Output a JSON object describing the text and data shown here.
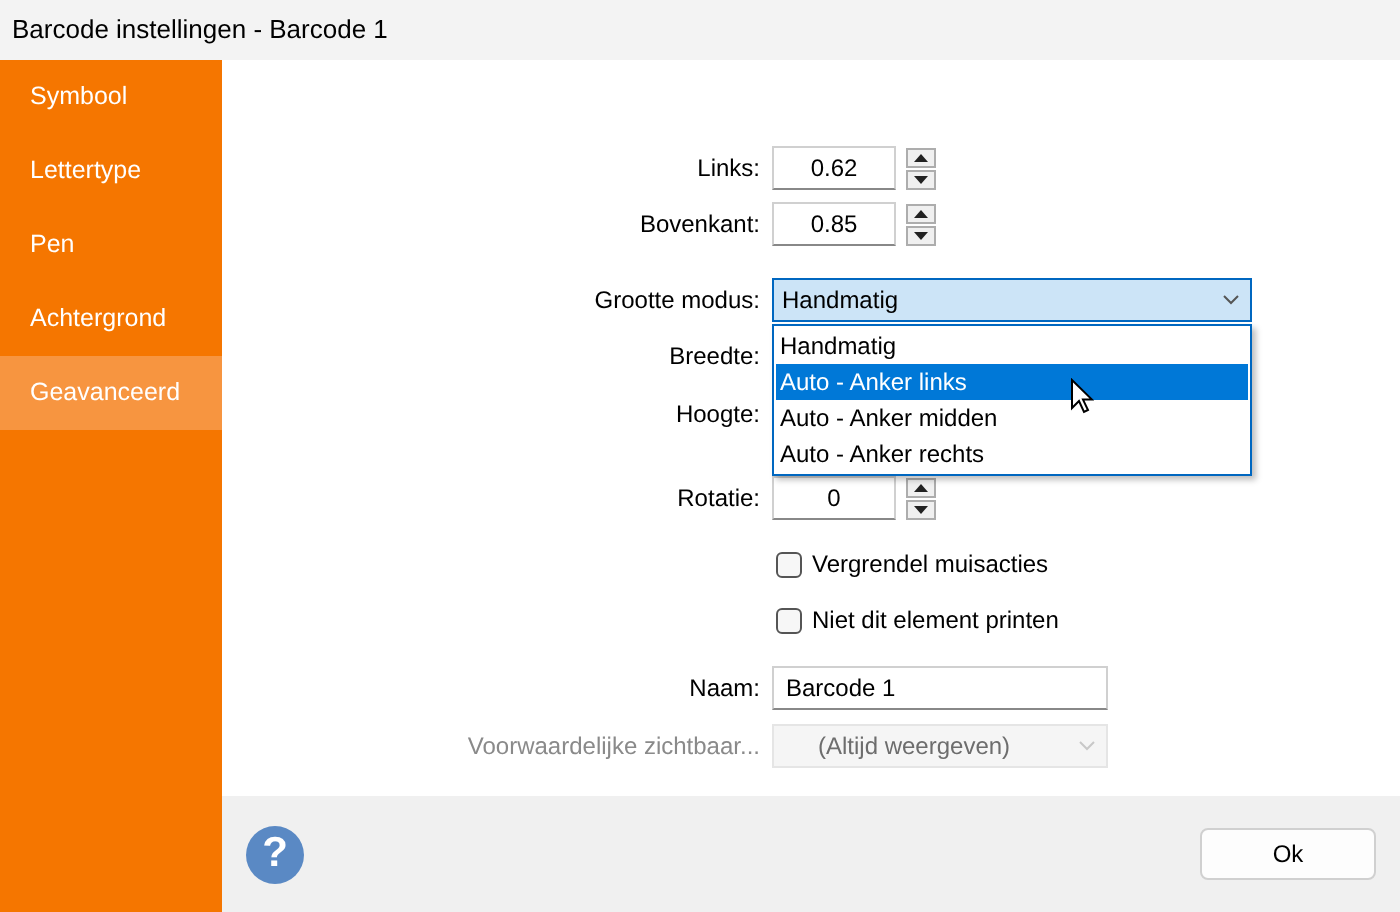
{
  "window": {
    "title": "Barcode instellingen - Barcode 1"
  },
  "sidebar": {
    "items": [
      {
        "label": "Symbool",
        "selected": false
      },
      {
        "label": "Lettertype",
        "selected": false
      },
      {
        "label": "Pen",
        "selected": false
      },
      {
        "label": "Achtergrond",
        "selected": false
      },
      {
        "label": "Geavanceerd",
        "selected": true
      }
    ]
  },
  "form": {
    "fields": [
      {
        "kind": "spinner",
        "label": "Links:",
        "value": "0.62"
      },
      {
        "kind": "spinner",
        "label": "Bovenkant:",
        "value": "0.85"
      },
      {
        "kind": "combo",
        "label": "Grootte modus:",
        "value": "Handmatig",
        "expanded": true,
        "options": [
          {
            "label": "Handmatig",
            "highlighted": false
          },
          {
            "label": "Auto - Anker links",
            "highlighted": true
          },
          {
            "label": "Auto - Anker midden",
            "highlighted": false
          },
          {
            "label": "Auto - Anker rechts",
            "highlighted": false
          }
        ]
      },
      {
        "kind": "covered",
        "label": "Breedte:"
      },
      {
        "kind": "covered",
        "label": "Hoogte:"
      },
      {
        "kind": "spinner",
        "label": "Rotatie:",
        "value": "0"
      },
      {
        "kind": "checkbox",
        "label": "Vergrendel muisacties",
        "checked": false
      },
      {
        "kind": "checkbox",
        "label": "Niet dit element printen",
        "checked": false
      },
      {
        "kind": "text",
        "label": "Naam:",
        "value": "Barcode 1"
      },
      {
        "kind": "combo",
        "label": "Voorwaardelijke zichtbaar...",
        "value": "(Altijd weergeven)",
        "disabled": true
      }
    ]
  },
  "footer": {
    "help": "?",
    "buttons": [
      "Ok"
    ]
  }
}
